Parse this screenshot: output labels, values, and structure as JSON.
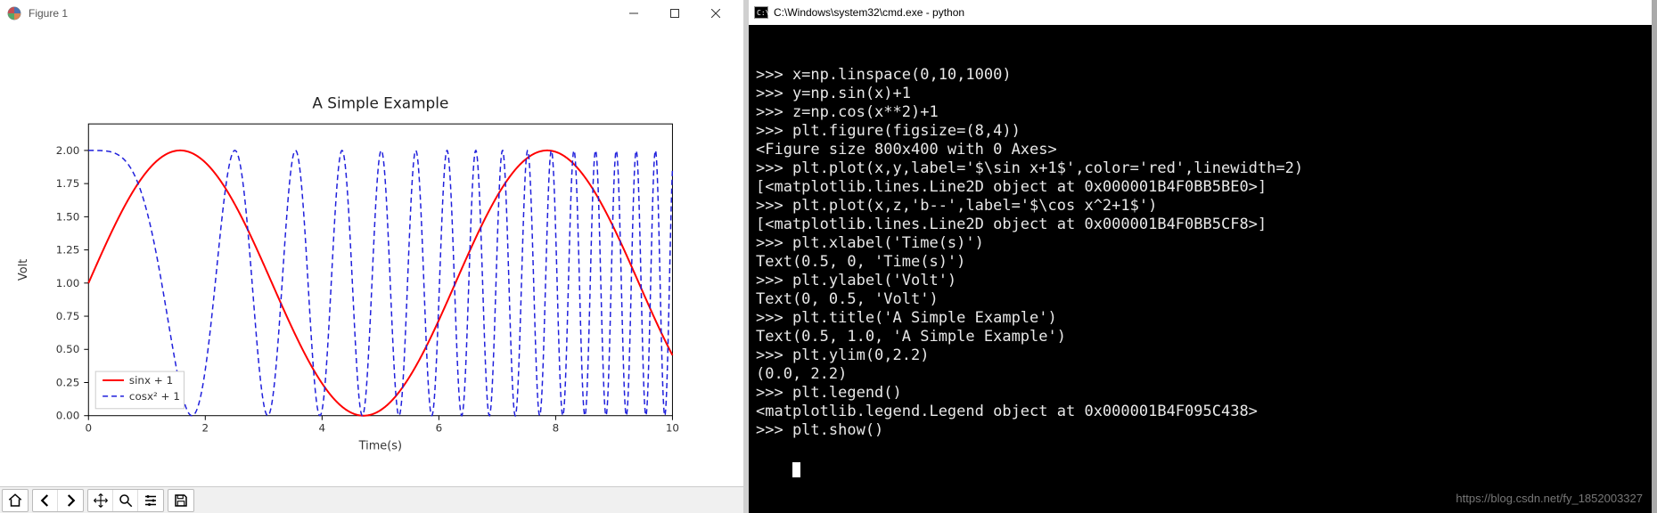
{
  "figure_window": {
    "title": "Figure 1"
  },
  "cmd_window": {
    "title": "C:\\Windows\\system32\\cmd.exe - python",
    "lines": [
      ">>> x=np.linspace(0,10,1000)",
      ">>> y=np.sin(x)+1",
      ">>> z=np.cos(x**2)+1",
      ">>> plt.figure(figsize=(8,4))",
      "<Figure size 800x400 with 0 Axes>",
      ">>> plt.plot(x,y,label='$\\sin x+1$',color='red',linewidth=2)",
      "[<matplotlib.lines.Line2D object at 0x000001B4F0BB5BE0>]",
      ">>> plt.plot(x,z,'b--',label='$\\cos x^2+1$')",
      "[<matplotlib.lines.Line2D object at 0x000001B4F0BB5CF8>]",
      ">>> plt.xlabel('Time(s)')",
      "Text(0.5, 0, 'Time(s)')",
      ">>> plt.ylabel('Volt')",
      "Text(0, 0.5, 'Volt')",
      ">>> plt.title('A Simple Example')",
      "Text(0.5, 1.0, 'A Simple Example')",
      ">>> plt.ylim(0,2.2)",
      "(0.0, 2.2)",
      ">>> plt.legend()",
      "<matplotlib.legend.Legend object at 0x000001B4F095C438>",
      ">>> plt.show()"
    ],
    "watermark": "https://blog.csdn.net/fy_1852003327"
  },
  "chart_data": {
    "type": "line",
    "title": "A Simple Example",
    "xlabel": "Time(s)",
    "ylabel": "Volt",
    "xlim": [
      0,
      10
    ],
    "ylim": [
      0,
      2.2
    ],
    "xticks": [
      0,
      2,
      4,
      6,
      8,
      10
    ],
    "yticks": [
      0.0,
      0.25,
      0.5,
      0.75,
      1.0,
      1.25,
      1.5,
      1.75,
      2.0
    ],
    "series": [
      {
        "name": "sinx + 1",
        "formula": "sin(x) + 1",
        "color": "#ff0000",
        "linewidth": 2,
        "dash": "solid"
      },
      {
        "name": "cosx² + 1",
        "formula": "cos(x^2) + 1",
        "color": "#1f1fdc",
        "linewidth": 1.5,
        "dash": "6,4"
      }
    ],
    "legend_position": "lower-left"
  }
}
